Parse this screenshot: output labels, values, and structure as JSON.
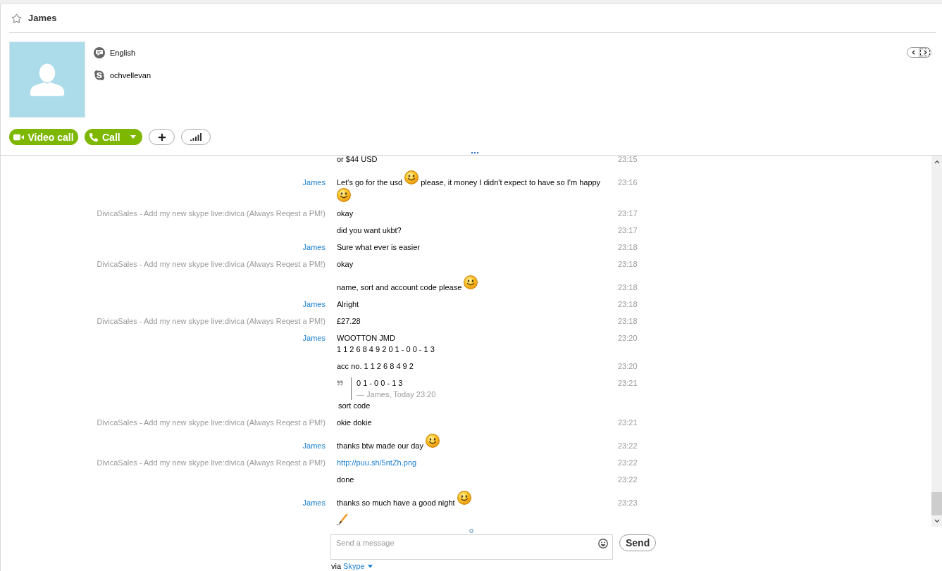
{
  "header": {
    "title": "James",
    "favorite": false
  },
  "profile": {
    "details": [
      {
        "kind": "language",
        "text": "English"
      },
      {
        "kind": "skype",
        "text": "ochvellevan"
      }
    ]
  },
  "pager": [
    {
      "kind": "previous",
      "focused": false
    },
    {
      "kind": "next",
      "focused": true
    }
  ],
  "actions": [
    {
      "kind": "video",
      "label": "Video call"
    },
    {
      "kind": "call",
      "label": "Call"
    },
    {
      "kind": "add"
    },
    {
      "kind": "signal"
    }
  ],
  "messages": [
    {
      "lines": [
        [
          {
            "kind": "text",
            "text": "or $44 USD"
          }
        ]
      ],
      "time": "23:15"
    },
    {
      "sender": {
        "name": "James",
        "self": true
      },
      "lines": [
        [
          {
            "kind": "text",
            "text": "Let's go for the usd"
          },
          {
            "kind": "emoji"
          },
          {
            "kind": "text",
            "text": "please, it money I didn't expect to have so I'm happy"
          }
        ],
        [
          {
            "kind": "emoji"
          }
        ]
      ],
      "time": "23:16"
    },
    {
      "sender": {
        "name": "DivicaSales - Add my new skype live:divica (Always Reqest a PM!)",
        "self": false
      },
      "lines": [
        [
          {
            "kind": "text",
            "text": "okay"
          }
        ]
      ],
      "time": "23:17"
    },
    {
      "lines": [
        [
          {
            "kind": "text",
            "text": "did you want ukbt?"
          }
        ]
      ],
      "time": "23:17"
    },
    {
      "sender": {
        "name": "James",
        "self": true
      },
      "lines": [
        [
          {
            "kind": "text",
            "text": "Sure what ever is easier"
          }
        ]
      ],
      "time": "23:18"
    },
    {
      "sender": {
        "name": "DivicaSales - Add my new skype live:divica (Always Reqest a PM!)",
        "self": false
      },
      "lines": [
        [
          {
            "kind": "text",
            "text": "okay"
          }
        ]
      ],
      "time": "23:18"
    },
    {
      "lines": [
        [
          {
            "kind": "text",
            "text": "name, sort and account code please"
          },
          {
            "kind": "emoji"
          }
        ]
      ],
      "time": "23:18"
    },
    {
      "sender": {
        "name": "James",
        "self": true
      },
      "lines": [
        [
          {
            "kind": "text",
            "text": "Alright"
          }
        ]
      ],
      "time": "23:18"
    },
    {
      "sender": {
        "name": "DivicaSales - Add my new skype live:divica (Always Reqest a PM!)",
        "self": false
      },
      "lines": [
        [
          {
            "kind": "text",
            "text": "£27.28"
          }
        ]
      ],
      "time": "23:18"
    },
    {
      "sender": {
        "name": "James",
        "self": true
      },
      "lines": [
        [
          {
            "kind": "text",
            "text": "WOOTTON JMD"
          }
        ],
        [
          {
            "kind": "text",
            "text": "1 1 2 6 8 4 9 2 0 1 - 0 0 - 1 3"
          }
        ]
      ],
      "time": "23:20"
    },
    {
      "lines": [
        [
          {
            "kind": "text",
            "text": "acc no. 1 1 2 6 8 4 9 2"
          }
        ]
      ],
      "time": "23:20"
    },
    {
      "quote": {
        "text": "0 1 - 0 0 - 1 3",
        "attribution": "— James, Today 23:20"
      },
      "lines": [
        [
          {
            "kind": "text",
            "text": "sort code"
          }
        ]
      ],
      "time": "23:21"
    },
    {
      "sender": {
        "name": "DivicaSales - Add my new skype live:divica (Always Reqest a PM!)",
        "self": false
      },
      "lines": [
        [
          {
            "kind": "text",
            "text": "okie dokie"
          }
        ]
      ],
      "time": "23:21"
    },
    {
      "sender": {
        "name": "James",
        "self": true
      },
      "lines": [
        [
          {
            "kind": "text",
            "text": "thanks btw made our day"
          },
          {
            "kind": "emoji"
          }
        ]
      ],
      "time": "23:22"
    },
    {
      "sender": {
        "name": "DivicaSales - Add my new skype live:divica (Always Reqest a PM!)",
        "self": false
      },
      "lines": [
        [
          {
            "kind": "link",
            "text": "http://puu.sh/5ntZh.png"
          }
        ]
      ],
      "time": "23:22"
    },
    {
      "lines": [
        [
          {
            "kind": "text",
            "text": "done"
          }
        ]
      ],
      "time": "23:22"
    },
    {
      "sender": {
        "name": "James",
        "self": true
      },
      "lines": [
        [
          {
            "kind": "text",
            "text": "thanks so much have a good night"
          },
          {
            "kind": "emoji"
          }
        ]
      ],
      "time": "23:23"
    }
  ],
  "typing": true,
  "composer": {
    "placeholder": "Send a message",
    "send": "Send",
    "via": "via",
    "service": "Skype"
  }
}
